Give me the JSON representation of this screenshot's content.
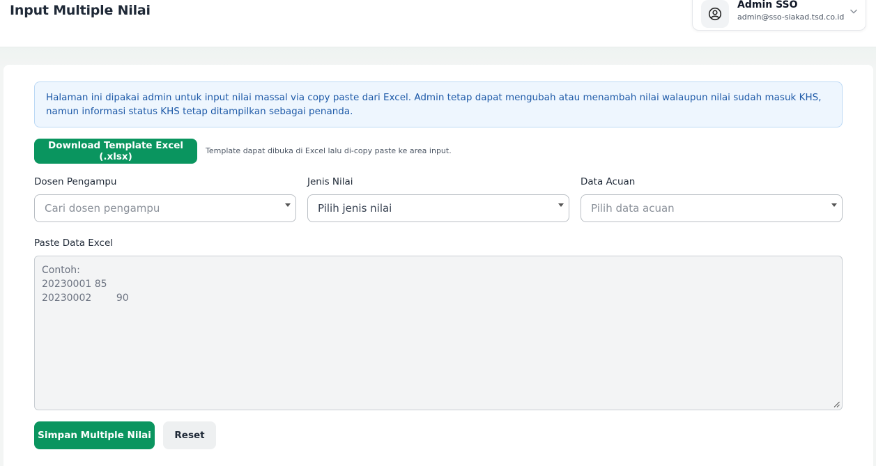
{
  "header": {
    "title": "Input Multiple Nilai",
    "user": {
      "name": "Admin SSO",
      "email": "admin@sso-siakad.tsd.co.id",
      "avatar_icon": "user-circle-icon",
      "menu_icon": "chevron-down-icon"
    }
  },
  "info": {
    "text": "Halaman ini dipakai admin untuk input nilai massal via copy paste dari Excel. Admin tetap dapat mengubah atau menambah nilai walaupun nilai sudah masuk KHS, namun informasi status KHS tetap ditampilkan sebagai penanda."
  },
  "download": {
    "label": "Download Template Excel (.xlsx)",
    "hint": "Template dapat dibuka di Excel lalu di-copy paste ke area input."
  },
  "form": {
    "dosen": {
      "label": "Dosen Pengampu",
      "placeholder": "Cari dosen pengampu"
    },
    "jenis": {
      "label": "Jenis Nilai",
      "value": "Pilih jenis nilai"
    },
    "acuan": {
      "label": "Data Acuan",
      "placeholder": "Pilih data acuan"
    },
    "paste": {
      "label": "Paste Data Excel",
      "placeholder": "Contoh:\n20230001 85\n20230002\t90"
    }
  },
  "actions": {
    "save_label": "Simpan Multiple Nilai",
    "reset_label": "Reset"
  },
  "colors": {
    "primary": "#0a955f",
    "info_bg": "#eef6fe",
    "info_text": "#1e5aa8"
  }
}
